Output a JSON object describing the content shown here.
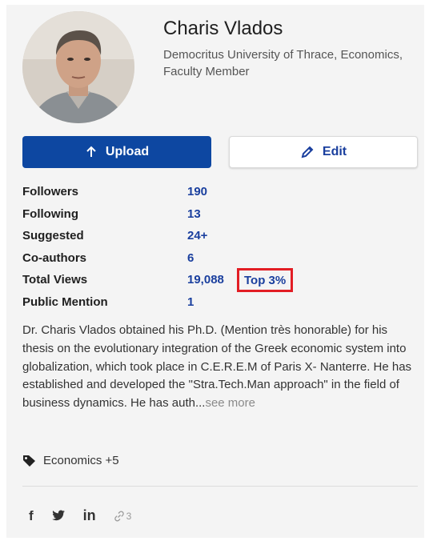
{
  "profile": {
    "name": "Charis Vlados",
    "affiliation": "Democritus University of Thrace, Economics, Faculty Member"
  },
  "buttons": {
    "upload_label": "Upload",
    "edit_label": "Edit"
  },
  "stats": [
    {
      "label": "Followers",
      "value": "190"
    },
    {
      "label": "Following",
      "value": "13"
    },
    {
      "label": "Suggested",
      "value": "24+"
    },
    {
      "label": "Co-authors",
      "value": "6"
    },
    {
      "label": "Total Views",
      "value": "19,088",
      "badge": "Top 3%"
    },
    {
      "label": "Public Mention",
      "value": "1"
    }
  ],
  "bio": {
    "text": "Dr. Charis Vlados obtained his Ph.D. (Mention très honorable) for his thesis on the evolutionary integration of the Greek economic system into globalization, which took place in C.E.R.E.M of Paris X- Nanterre. He has established and developed the \"Stra.Tech.Man approach\" in the field of business dynamics. He has auth...",
    "see_more": "see more"
  },
  "topics": {
    "label": "Economics +5"
  },
  "social": {
    "facebook": "f",
    "linkedin": "in",
    "links_count": "3"
  },
  "colors": {
    "primary": "#0d47a1",
    "link": "#1a3f9e",
    "highlight_border": "#e21d24",
    "card_bg": "#f4f4f4"
  }
}
